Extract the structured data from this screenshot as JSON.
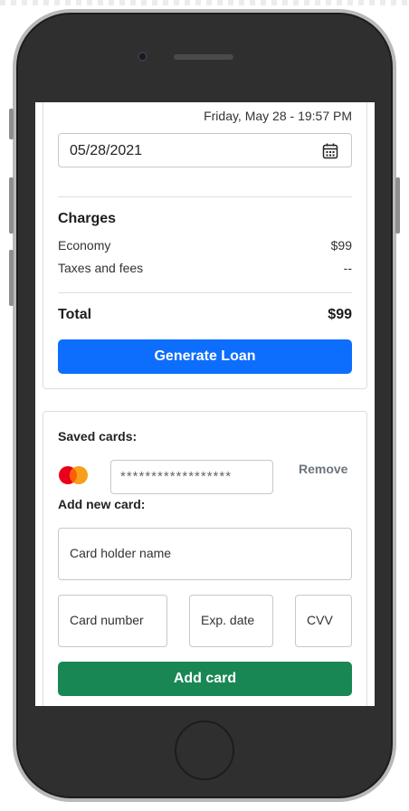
{
  "booking": {
    "datetime_text": "Friday, May 28 - 19:57 PM",
    "date_input_value": "05/28/2021"
  },
  "charges": {
    "title": "Charges",
    "items": [
      {
        "label": "Economy",
        "value": "$99"
      },
      {
        "label": "Taxes and fees",
        "value": "--"
      }
    ],
    "total_label": "Total",
    "total_value": "$99",
    "generate_button": "Generate Loan"
  },
  "payment": {
    "saved_cards_label": "Saved cards:",
    "saved_card_value": "******************",
    "saved_card_brand_icon": "mastercard-icon",
    "remove_label": "Remove",
    "add_new_label": "Add new card:",
    "fields": {
      "holder_name": "Card holder name",
      "card_number": "Card number",
      "exp_date": "Exp. date",
      "cvv": "CVV"
    },
    "add_button": "Add card"
  },
  "colors": {
    "primary": "#0d6efd",
    "success": "#198754",
    "muted": "#6c757d",
    "mastercard_red": "#eb001b",
    "mastercard_orange": "#f79e1b"
  }
}
